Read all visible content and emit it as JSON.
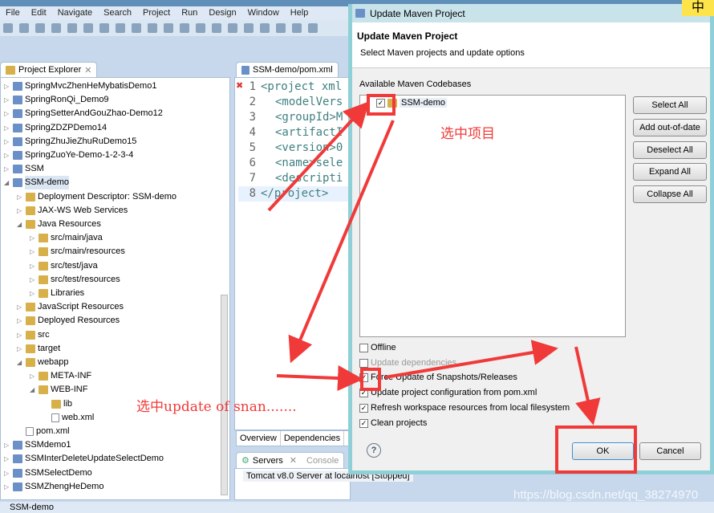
{
  "menu": [
    "File",
    "Edit",
    "Navigate",
    "Search",
    "Project",
    "Run",
    "Design",
    "Window",
    "Help"
  ],
  "explorer": {
    "tab": "Project Explorer",
    "items": [
      {
        "label": "SpringMvcZhenHeMybatisDemo1",
        "depth": 0,
        "type": "project"
      },
      {
        "label": "SpringRonQi_Demo9",
        "depth": 0,
        "type": "project"
      },
      {
        "label": "SpringSetterAndGouZhao-Demo12",
        "depth": 0,
        "type": "project"
      },
      {
        "label": "SpringZDZPDemo14",
        "depth": 0,
        "type": "project"
      },
      {
        "label": "SpringZhuJieZhuRuDemo15",
        "depth": 0,
        "type": "project"
      },
      {
        "label": "SpringZuoYe-Demo-1-2-3-4",
        "depth": 0,
        "type": "project"
      },
      {
        "label": "SSM",
        "depth": 0,
        "type": "project"
      },
      {
        "label": "SSM-demo",
        "depth": 0,
        "type": "project",
        "expanded": true
      },
      {
        "label": "Deployment Descriptor: SSM-demo",
        "depth": 1,
        "type": "folder"
      },
      {
        "label": "JAX-WS Web Services",
        "depth": 1,
        "type": "folder"
      },
      {
        "label": "Java Resources",
        "depth": 1,
        "type": "folder",
        "expanded": true
      },
      {
        "label": "src/main/java",
        "depth": 2,
        "type": "folder"
      },
      {
        "label": "src/main/resources",
        "depth": 2,
        "type": "folder"
      },
      {
        "label": "src/test/java",
        "depth": 2,
        "type": "folder"
      },
      {
        "label": "src/test/resources",
        "depth": 2,
        "type": "folder"
      },
      {
        "label": "Libraries",
        "depth": 2,
        "type": "folder"
      },
      {
        "label": "JavaScript Resources",
        "depth": 1,
        "type": "folder"
      },
      {
        "label": "Deployed Resources",
        "depth": 1,
        "type": "folder"
      },
      {
        "label": "src",
        "depth": 1,
        "type": "folder"
      },
      {
        "label": "target",
        "depth": 1,
        "type": "folder"
      },
      {
        "label": "webapp",
        "depth": 1,
        "type": "folder",
        "expanded": true
      },
      {
        "label": "META-INF",
        "depth": 2,
        "type": "folder"
      },
      {
        "label": "WEB-INF",
        "depth": 2,
        "type": "folder",
        "expanded": true
      },
      {
        "label": "lib",
        "depth": 3,
        "type": "folder",
        "leaf": true
      },
      {
        "label": "web.xml",
        "depth": 3,
        "type": "file",
        "leaf": true
      },
      {
        "label": "pom.xml",
        "depth": 1,
        "type": "file",
        "leaf": true
      },
      {
        "label": "SSMdemo1",
        "depth": 0,
        "type": "project"
      },
      {
        "label": "SSMInterDeleteUpdateSelectDemo",
        "depth": 0,
        "type": "project"
      },
      {
        "label": "SSMSelectDemo",
        "depth": 0,
        "type": "project"
      },
      {
        "label": "SSMZhengHeDemo",
        "depth": 0,
        "type": "project"
      }
    ]
  },
  "editor": {
    "tab": "SSM-demo/pom.xml",
    "lines": [
      "<project xml",
      "<modelVers",
      "<groupId>M",
      "<artifactI",
      "<version>0",
      "<name>sele",
      "<descripti",
      "</project>"
    ],
    "bottom_tabs": [
      "Overview",
      "Dependencies",
      "D"
    ]
  },
  "servers": {
    "tab": "Servers",
    "console_tab": "Console",
    "item": "Tomcat v8.0 Server at localhost  [Stopped]"
  },
  "status": "SSM-demo",
  "dialog": {
    "title": "Update Maven Project",
    "heading": "Update Maven Project",
    "subtitle": "Select Maven projects and update options",
    "codebases_label": "Available Maven Codebases",
    "codebase": {
      "label": "SSM-demo",
      "checked": true
    },
    "side_buttons": [
      "Select All",
      "Add out-of-date",
      "Deselect All",
      "Expand All",
      "Collapse All"
    ],
    "options": [
      {
        "label": "Offline",
        "checked": false
      },
      {
        "label": "Update dependencies",
        "checked": false,
        "disabled": true
      },
      {
        "label": "Force Update of Snapshots/Releases",
        "checked": true
      },
      {
        "label": "Update project configuration from pom.xml",
        "checked": true
      },
      {
        "label": "Refresh workspace resources from local filesystem",
        "checked": true
      },
      {
        "label": "Clean projects",
        "checked": true
      }
    ],
    "ok": "OK",
    "cancel": "Cancel"
  },
  "annotations": {
    "select_project": "选中项目",
    "select_update": "选中update of snan.......",
    "color": "#f03a3a"
  },
  "ime": "中",
  "watermark": "https://blog.csdn.net/qq_38274970"
}
